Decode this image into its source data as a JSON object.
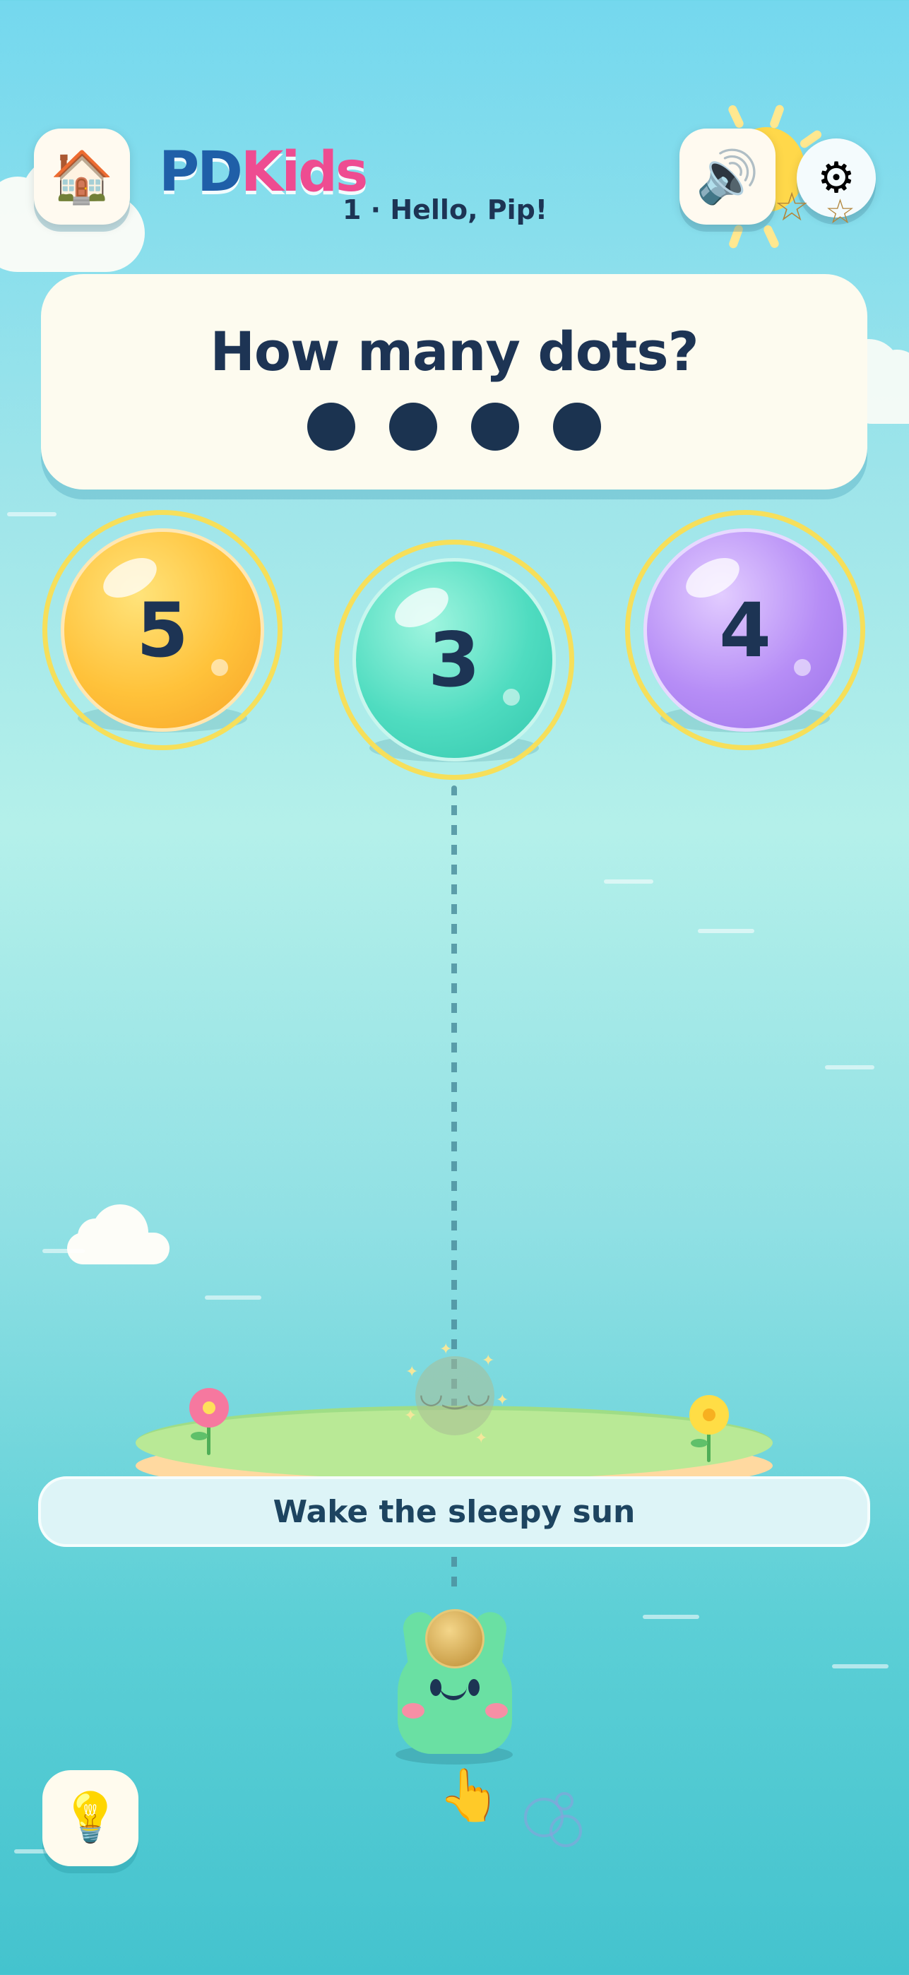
{
  "header": {
    "home_icon": "house-icon",
    "logo_pd": "PD",
    "logo_kids": "Kids",
    "level_label": "1 · Hello, Pip!",
    "sound_icon": "speaker-icon",
    "settings_icon": "gear-icon"
  },
  "question": {
    "prompt": "How many dots?",
    "dot_count": 4
  },
  "answers": [
    {
      "value": "5",
      "color": "#ffc23a"
    },
    {
      "value": "3",
      "color": "#4fdcc0"
    },
    {
      "value": "4",
      "color": "#b68df6"
    }
  ],
  "banner": {
    "text": "Wake the sleepy sun"
  },
  "footer": {
    "hint_icon": "lightbulb-icon",
    "pointer_icon": "pointing-hand-icon",
    "bubbles_icon": "bubbles-icon"
  },
  "colors": {
    "accent_blue": "#1f5fa8",
    "accent_pink": "#ee4c91",
    "text_dark": "#1d3454"
  }
}
